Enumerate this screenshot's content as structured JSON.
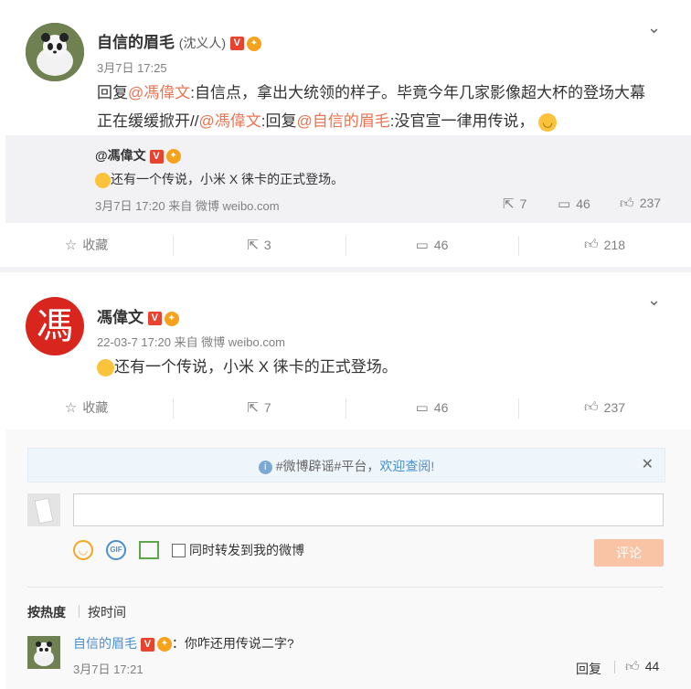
{
  "post1": {
    "author": "自信的眉毛",
    "alias": "(沈义人)",
    "time": "3月7日 17:25",
    "text_prefix": "回复",
    "mention1": "@馮偉文",
    "text_mid1": ":自信点，拿出大统领的样子。毕竟今年几家影像超大杯的登场大幕",
    "text_line2_a": "正在缓缓掀开//",
    "mention2": "@馮偉文",
    "text_mid2": ":回复",
    "mention3": "@自信的眉毛",
    "text_end": ":没官宣一律用传说，",
    "quote": {
      "author": "@馮偉文",
      "text": "还有一个传说，小米 X 徕卡的正式登场。",
      "meta": "3月7日 17:20 来自 微博 weibo.com",
      "repost": "7",
      "comment": "46",
      "like": "237"
    },
    "actions": {
      "fav": "收藏",
      "repost": "3",
      "comment": "46",
      "like": "218"
    }
  },
  "post2": {
    "author": "馮偉文",
    "avatar_char": "馮",
    "meta": "22-03-7 17:20 来自 微博 weibo.com",
    "text": "还有一个传说，小米 X 徕卡的正式登场。",
    "actions": {
      "fav": "收藏",
      "repost": "7",
      "comment": "46",
      "like": "237"
    }
  },
  "comment_box": {
    "notice_prefix": "#微博辟谣#平台，",
    "notice_link": "欢迎查阅!",
    "checkbox_label": "同时转发到我的微博",
    "submit": "评论"
  },
  "sort": {
    "hot": "按热度",
    "time": "按时间"
  },
  "comment": {
    "author": "自信的眉毛",
    "text": "：你咋还用传说二字?",
    "time": "3月7日 17:21",
    "reply": "回复",
    "likes": "44"
  }
}
